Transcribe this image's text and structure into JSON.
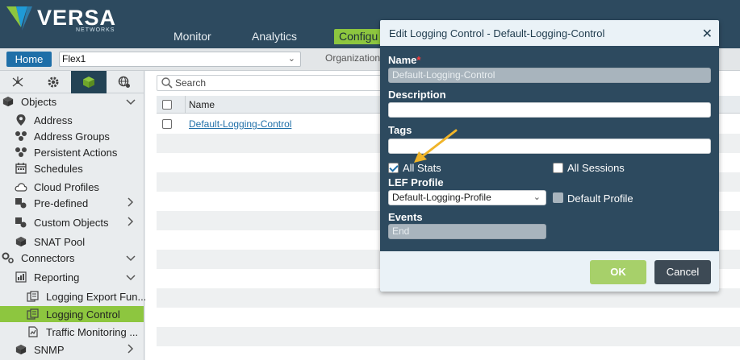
{
  "brand": {
    "name": "VERSA",
    "sub": "NETWORKS",
    "logo_colors": [
      "#8dc63f",
      "#1f9ad6",
      "#2d7ba8"
    ]
  },
  "nav": {
    "items": [
      "Monitor",
      "Analytics",
      "Configu"
    ],
    "active": "Configu"
  },
  "toolbar": {
    "home_label": "Home",
    "appliance_value": "Flex1",
    "org_label": "Organization"
  },
  "sidebar": {
    "tabs": [
      "network-icon",
      "gear-icon",
      "cube-icon",
      "globe-icon"
    ],
    "active_tab": "cube-icon",
    "items": [
      {
        "label": "Objects",
        "icon": "cube-icon",
        "chevron": "down"
      },
      {
        "label": "Address",
        "icon": "map-pin-icon"
      },
      {
        "label": "Address Groups",
        "icon": "address-group-icon"
      },
      {
        "label": "Persistent Actions",
        "icon": "persistent-actions-icon"
      },
      {
        "label": "Schedules",
        "icon": "calendar-icon"
      },
      {
        "label": "Cloud Profiles",
        "icon": "cloud-icon"
      },
      {
        "label": "Pre-defined",
        "icon": "predefined-icon",
        "chevron": "right"
      },
      {
        "label": "Custom Objects",
        "icon": "custom-objects-icon",
        "chevron": "right"
      },
      {
        "label": "SNAT Pool",
        "icon": "snat-pool-icon"
      },
      {
        "label": "Connectors",
        "icon": "connectors-icon",
        "chevron": "down"
      },
      {
        "label": "Reporting",
        "icon": "reporting-icon",
        "chevron": "down"
      },
      {
        "label": "Logging Export Fun...",
        "icon": "logging-export-icon"
      },
      {
        "label": "Logging Control",
        "icon": "logging-control-icon",
        "selected": true
      },
      {
        "label": "Traffic Monitoring ...",
        "icon": "traffic-monitoring-icon"
      },
      {
        "label": "SNMP",
        "icon": "snmp-icon",
        "chevron": "right"
      }
    ]
  },
  "content": {
    "search_placeholder": "Search",
    "column_name": "Name",
    "rows": [
      "Default-Logging-Control"
    ]
  },
  "modal": {
    "title": "Edit Logging Control - Default-Logging-Control",
    "name_label": "Name",
    "required_mark": "*",
    "name_value": "Default-Logging-Control",
    "description_label": "Description",
    "description_value": "",
    "tags_label": "Tags",
    "tags_value": "",
    "all_stats_label": "All Stats",
    "all_stats_checked": true,
    "all_sessions_label": "All Sessions",
    "all_sessions_checked": false,
    "lef_profile_label": "LEF Profile",
    "lef_profile_value": "Default-Logging-Profile",
    "default_profile_label": "Default Profile",
    "default_profile_checked": false,
    "events_label": "Events",
    "events_value": "End",
    "ok_label": "OK",
    "cancel_label": "Cancel"
  },
  "colors": {
    "header_bg": "#2d4a5f",
    "accent_green": "#8dc63f",
    "link_blue": "#1f6fa8",
    "modal_bg": "#2d4a5f",
    "annotation_arrow": "#f0b429"
  }
}
